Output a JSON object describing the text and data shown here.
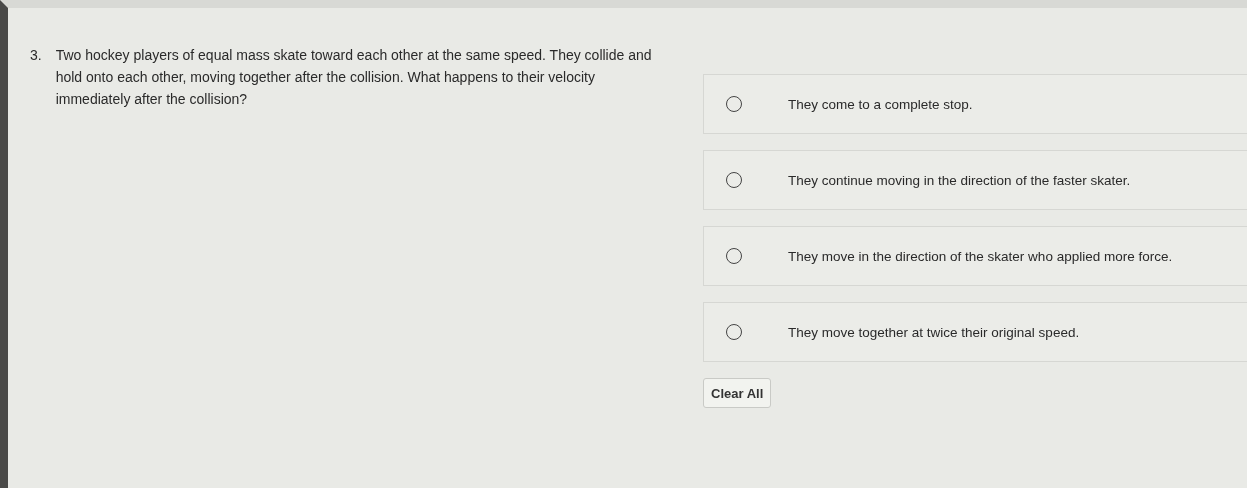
{
  "question": {
    "number": "3.",
    "text": "Two hockey players of equal mass skate toward each other at the same speed. They collide and hold onto each other, moving together after the collision. What happens to their velocity immediately after the collision?"
  },
  "options": [
    {
      "label": "They come to a complete stop.",
      "selected": false
    },
    {
      "label": "They continue moving in the direction of the faster skater.",
      "selected": false
    },
    {
      "label": "They move in the direction of the skater who applied more force.",
      "selected": false
    },
    {
      "label": "They move together at twice their original speed.",
      "selected": false
    }
  ],
  "clear_button": "Clear All"
}
